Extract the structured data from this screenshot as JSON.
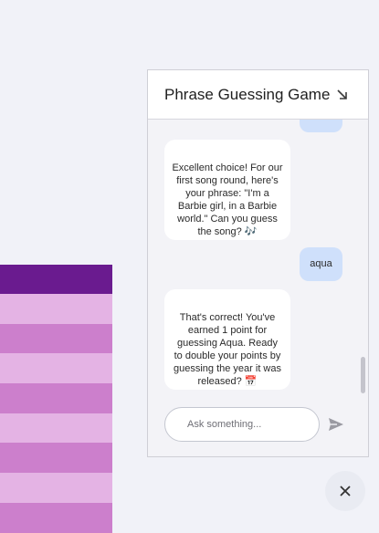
{
  "chat": {
    "title": "Phrase Guessing Game",
    "messages": [
      {
        "role": "user",
        "text": "..."
      },
      {
        "role": "bot",
        "text": "Excellent choice! For our first song round, here's your phrase: \"I'm a Barbie girl, in a Barbie world.\" Can you guess the song? 🎶"
      },
      {
        "role": "user",
        "text": "aqua"
      },
      {
        "role": "bot",
        "text": "That's correct! You've earned 1 point for guessing Aqua. Ready to double your points by guessing the year it was released? 📅"
      }
    ],
    "input": {
      "placeholder": "Ask something..."
    }
  },
  "icons": {
    "collapse": "arrow-down-right-icon",
    "send": "send-icon",
    "close": "close-icon"
  },
  "colors": {
    "bot_bubble": "#ffffff",
    "user_bubble": "#cfe0fb",
    "table_header": "#6a1b8f",
    "table_row_light": "#e4b3e4",
    "table_row_dark": "#cc7fcc"
  }
}
